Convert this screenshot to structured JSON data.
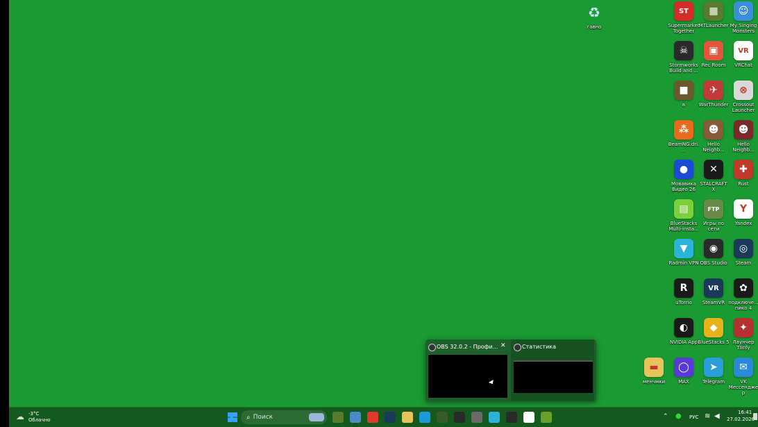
{
  "desktop": {
    "recycle_bin": {
      "label": "гавно",
      "icon": "recycle-bin-icon"
    },
    "icons": [
      {
        "label": "Supermarket Together",
        "icon": "supermarket-together-icon",
        "color": "#d42b2b",
        "glyph": "ST"
      },
      {
        "label": "MTLauncher",
        "icon": "mtlauncher-icon",
        "color": "#5a7a2e",
        "glyph": "▦"
      },
      {
        "label": "My Singing Monsters",
        "icon": "my-singing-monsters-icon",
        "color": "#3b8fd6",
        "glyph": "☺"
      },
      {
        "label": "Stormworks Build and ...",
        "icon": "stormworks-icon",
        "color": "#2a2a2a",
        "glyph": "☠"
      },
      {
        "label": "Rec Room",
        "icon": "rec-room-icon",
        "color": "#e2573b",
        "glyph": "▣"
      },
      {
        "label": "VRChat",
        "icon": "vrchat-icon",
        "color": "#ffffff",
        "glyph": "VR"
      },
      {
        "label": "в",
        "icon": "minecraft-block-icon",
        "color": "#6b5a2e",
        "glyph": "■"
      },
      {
        "label": "WarThunder",
        "icon": "warthunder-icon",
        "color": "#c23b3b",
        "glyph": "✈"
      },
      {
        "label": "Crossout Launcher",
        "icon": "crossout-icon",
        "color": "#d9d9d9",
        "glyph": "⊗"
      },
      {
        "label": "BeamNG.dri...",
        "icon": "beamng-icon",
        "color": "#e86a1a",
        "glyph": "⁂"
      },
      {
        "label": "Hello Neighb...",
        "icon": "hello-neighbor-icon",
        "color": "#8a5a3a",
        "glyph": "☻"
      },
      {
        "label": "Hello Neighb...",
        "icon": "hello-neighbor-2-icon",
        "color": "#7a2a2a",
        "glyph": "☻"
      },
      {
        "label": "Мовавика Видео 26",
        "icon": "movavi-icon",
        "color": "#1a4ad6",
        "glyph": "●"
      },
      {
        "label": "STALCRAFT X",
        "icon": "stalcraft-icon",
        "color": "#1a1a1a",
        "glyph": "✕"
      },
      {
        "label": "Rust",
        "icon": "rust-icon",
        "color": "#c0392b",
        "glyph": "✚"
      },
      {
        "label": "BlueStacks Multi-insta...",
        "icon": "bluestacks-multi-icon",
        "color": "#7bd13b",
        "glyph": "▤"
      },
      {
        "label": "Игры по сети",
        "icon": "ftp-icon",
        "color": "#6a8a4a",
        "glyph": "FTP"
      },
      {
        "label": "Yandex",
        "icon": "yandex-browser-icon",
        "color": "#ffffff",
        "glyph": "Y"
      },
      {
        "label": "Radmin VPN",
        "icon": "radmin-vpn-icon",
        "color": "#2bb3d9",
        "glyph": "▼"
      },
      {
        "label": "OBS Studio",
        "icon": "obs-studio-icon",
        "color": "#2a2a2a",
        "glyph": "◉"
      },
      {
        "label": "Steam",
        "icon": "steam-icon",
        "color": "#1b3a5a",
        "glyph": "◎"
      },
      {
        "label": "uTorrio",
        "icon": "utorrio-icon",
        "color": "#1a1a1a",
        "glyph": "R"
      },
      {
        "label": "SteamVR",
        "icon": "steamvr-icon",
        "color": "#1b3a5a",
        "glyph": "VR"
      },
      {
        "label": "подключе... пико 4",
        "icon": "pico-connect-icon",
        "color": "#1a1a1a",
        "glyph": "✿"
      },
      {
        "label": "NVIDIA App",
        "icon": "nvidia-app-icon",
        "color": "#1a1a1a",
        "glyph": "◐"
      },
      {
        "label": "BlueStacks 5",
        "icon": "bluestacks-5-icon",
        "color": "#e8b21a",
        "glyph": "◆"
      },
      {
        "label": "Лаунчер Tlinfy",
        "icon": "tlinfy-launcher-icon",
        "color": "#b53030",
        "glyph": "✦"
      },
      {
        "label": "менчмки",
        "icon": "folder-icon",
        "color": "#e8c25a",
        "glyph": "▬"
      },
      {
        "label": "MAX",
        "icon": "max-icon",
        "color": "#5a3ad6",
        "glyph": "◯"
      },
      {
        "label": "Telegram",
        "icon": "telegram-icon",
        "color": "#2a9ed8",
        "glyph": "➤"
      },
      {
        "label": "VK Мессенджер",
        "icon": "vk-messenger-icon",
        "color": "#2a8ad8",
        "glyph": "✉"
      }
    ]
  },
  "taskbar": {
    "weather": {
      "temp": "-3°C",
      "desc": "Облачно"
    },
    "search_placeholder": "Поиск",
    "pinned": [
      {
        "icon": "start-icon",
        "color": "#3aa0ff"
      },
      {
        "icon": "minecraft-icon",
        "color": "#5a7a2e"
      },
      {
        "icon": "game-launcher-icon",
        "color": "#4a8ac9"
      },
      {
        "icon": "yandex-icon",
        "color": "#e03a2a"
      },
      {
        "icon": "steam-taskbar-icon",
        "color": "#1b3a5a"
      },
      {
        "icon": "file-explorer-icon",
        "color": "#e8c25a"
      },
      {
        "icon": "edge-icon",
        "color": "#1a9ad6"
      },
      {
        "icon": "cube-game-icon",
        "color": "#3a5a2a"
      },
      {
        "icon": "stormworks-taskbar-icon",
        "color": "#2a2a2a"
      },
      {
        "icon": "warthunder-taskbar-icon",
        "color": "#6a6a6a"
      },
      {
        "icon": "radmin-taskbar-icon",
        "color": "#2bb3d9"
      },
      {
        "icon": "obs-taskbar-icon",
        "color": "#2a2a2a"
      },
      {
        "icon": "yandex-browser-taskbar-icon",
        "color": "#ffffff"
      },
      {
        "icon": "minecraft-launcher-taskbar-icon",
        "color": "#6aa02a"
      }
    ],
    "tray": {
      "language": "РУС",
      "time": "16:41",
      "date": "27.02.2026"
    }
  },
  "preview_popup": {
    "windows": [
      {
        "title": "OBS 32.0.2 - Профи...",
        "close_glyph": "✕"
      },
      {
        "title": "Статистика"
      }
    ]
  }
}
